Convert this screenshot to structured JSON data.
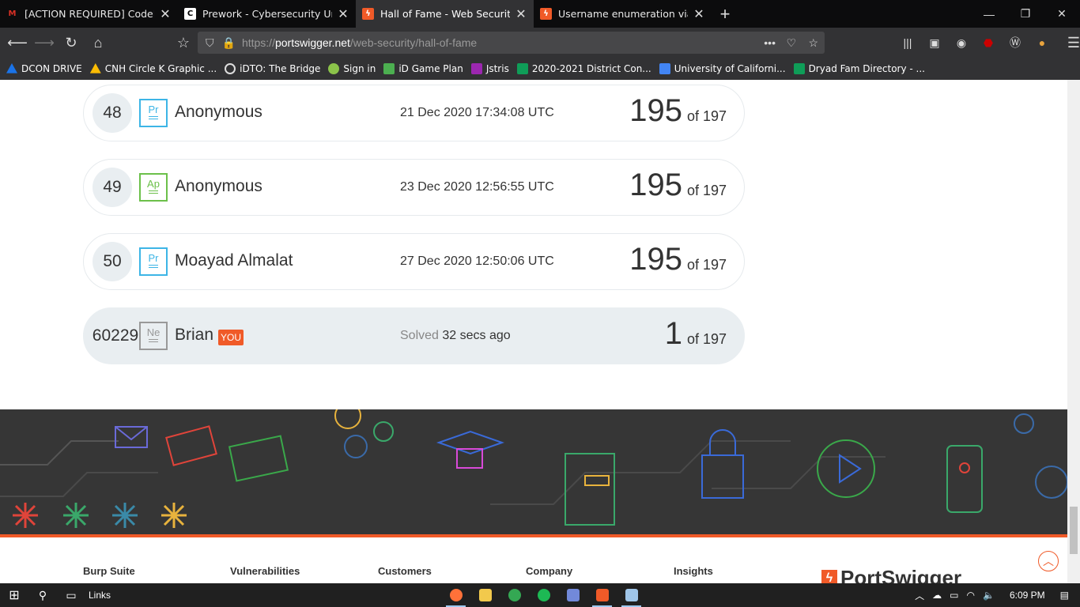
{
  "tabs": [
    {
      "title": "[ACTION REQUIRED] CodePath",
      "icon": "gmail-icon",
      "color": "#d93025"
    },
    {
      "title": "Prework - Cybersecurity Univer",
      "icon": "codepath-icon",
      "color": "#ffffff"
    },
    {
      "title": "Hall of Fame - Web Security Ac",
      "icon": "portswigger-icon",
      "color": "#f05a28"
    },
    {
      "title": "Username enumeration via diff",
      "icon": "portswigger-icon",
      "color": "#f05a28"
    }
  ],
  "url": {
    "scheme": "https://",
    "host": "portswigger.net",
    "path": "/web-security/hall-of-fame"
  },
  "bookmarks": [
    {
      "label": "DCON DRIVE",
      "color": "#1a73e8"
    },
    {
      "label": "CNH Circle K Graphic ...",
      "color": "#fbbc04"
    },
    {
      "label": "iDTO: The Bridge",
      "color": "#dddddd"
    },
    {
      "label": "Sign in",
      "color": "#8bc34a"
    },
    {
      "label": "iD Game Plan",
      "color": "#4caf50"
    },
    {
      "label": "Jstris",
      "color": "#9c27b0"
    },
    {
      "label": "2020-2021 District Con...",
      "color": "#0f9d58"
    },
    {
      "label": "University of Californi...",
      "color": "#4285f4"
    },
    {
      "label": "Dryad Fam Directory - ...",
      "color": "#0f9d58"
    }
  ],
  "leaderboard": [
    {
      "rank": "48",
      "badge": "Pr",
      "badge_color": "#3db5e6",
      "name": "Anonymous",
      "date": "21 Dec 2020 17:34:08 UTC",
      "score": "195",
      "of": "of 197"
    },
    {
      "rank": "49",
      "badge": "Ap",
      "badge_color": "#6cc04a",
      "name": "Anonymous",
      "date": "23 Dec 2020 12:56:55 UTC",
      "score": "195",
      "of": "of 197"
    },
    {
      "rank": "50",
      "badge": "Pr",
      "badge_color": "#3db5e6",
      "name": "Moayad Almalat",
      "date": "27 Dec 2020 12:50:06 UTC",
      "score": "195",
      "of": "of 197"
    }
  ],
  "you_row": {
    "rank": "60229",
    "badge": "Ne",
    "badge_color": "#999999",
    "name": "Brian",
    "you_tag": "YOU",
    "solved_label": "Solved",
    "solved_time": "32 secs ago",
    "score": "1",
    "of": "of 197"
  },
  "footer": {
    "columns": [
      "Burp Suite",
      "Vulnerabilities",
      "Customers",
      "Company",
      "Insights"
    ],
    "brand": "PortSwigger"
  },
  "taskbar": {
    "search_label": "Links",
    "time": "6:09 PM"
  },
  "colors": {
    "accent": "#f05a28"
  }
}
